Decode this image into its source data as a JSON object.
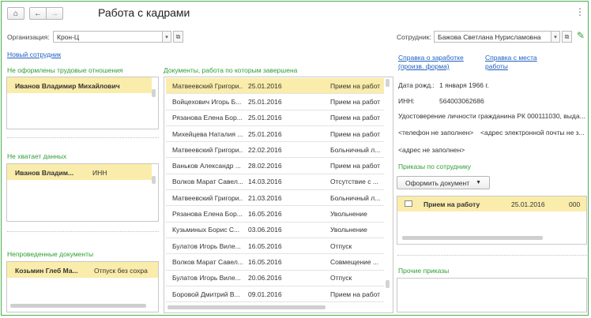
{
  "header": {
    "home_icon": "home-icon",
    "back_icon": "arrow-left-icon",
    "forward_icon": "arrow-right-icon",
    "title": "Работа с кадрами",
    "settings_icon": "gear-icon"
  },
  "org": {
    "label": "Организация:",
    "value": "Крон-Ц"
  },
  "employee": {
    "label": "Сотрудник:",
    "value": "Бажова Светлана Нурисламовна"
  },
  "new_employee_link": "Новый сотрудник",
  "unregistered": {
    "title": "Не оформлены трудовые отношения",
    "rows": [
      "Иванов Владимир Михайлович"
    ]
  },
  "missing_data": {
    "title": "Не хватает данных",
    "rows": [
      {
        "name": "Иванов Владим...",
        "field": "ИНН"
      }
    ]
  },
  "unposted": {
    "title": "Непроведенные документы",
    "rows": [
      {
        "name": "Козьмин Глеб Ма...",
        "doc": "Отпуск без сохра"
      }
    ]
  },
  "completed_docs": {
    "title": "Документы, работа по которым завершена",
    "rows": [
      {
        "name": "Матвеевский Григори...",
        "date": "25.01.2016",
        "doc": "Прием на работ"
      },
      {
        "name": "Войцехович Игорь Б...",
        "date": "25.01.2016",
        "doc": "Прием на работ"
      },
      {
        "name": "Рязанова Елена Бор...",
        "date": "25.01.2016",
        "doc": "Прием на работ"
      },
      {
        "name": "Михейцева Наталия ...",
        "date": "25.01.2016",
        "doc": "Прием на работ"
      },
      {
        "name": "Матвеевский Григори...",
        "date": "22.02.2016",
        "doc": "Больничный л..."
      },
      {
        "name": "Ваньков Александр ...",
        "date": "28.02.2016",
        "doc": "Прием на работ"
      },
      {
        "name": "Волков Марат Савел...",
        "date": "14.03.2016",
        "doc": "Отсутствие с ..."
      },
      {
        "name": "Матвеевский Григори...",
        "date": "21.03.2016",
        "doc": "Больничный л..."
      },
      {
        "name": "Рязанова Елена Бор...",
        "date": "16.05.2016",
        "doc": "Увольнение"
      },
      {
        "name": "Кузьминых Борис С...",
        "date": "03.06.2016",
        "doc": "Увольнение"
      },
      {
        "name": "Булатов Игорь Виле...",
        "date": "16.05.2016",
        "doc": "Отпуск"
      },
      {
        "name": "Волков Марат Савел...",
        "date": "16.05.2016",
        "doc": "Совмещение ..."
      },
      {
        "name": "Булатов Игорь Виле...",
        "date": "20.06.2016",
        "doc": "Отпуск"
      },
      {
        "name": "Боровой Дмитрий В...",
        "date": "09.01.2016",
        "doc": "Прием на работ"
      }
    ]
  },
  "links": {
    "salary_cert": "Справка о заработке (произв. форма)",
    "work_cert": "Справка с места работы"
  },
  "info": {
    "dob_label": "Дата рожд.:",
    "dob_value": "1 января 1966 г.",
    "inn_label": "ИНН:",
    "inn_value": "564003062686",
    "id_doc": "Удостоверение личности гражданина РК 000111030, выда...",
    "phone": "<телефон не заполнен>",
    "email": "<адрес электронной почты не з...",
    "address": "<адрес не заполнен>"
  },
  "orders": {
    "title": "Приказы по сотруднику",
    "button": "Оформить документ",
    "rows": [
      {
        "doc": "Прием на работу",
        "date": "25.01.2016",
        "extra": "000"
      }
    ]
  },
  "other_orders": {
    "title": "Прочие приказы"
  }
}
